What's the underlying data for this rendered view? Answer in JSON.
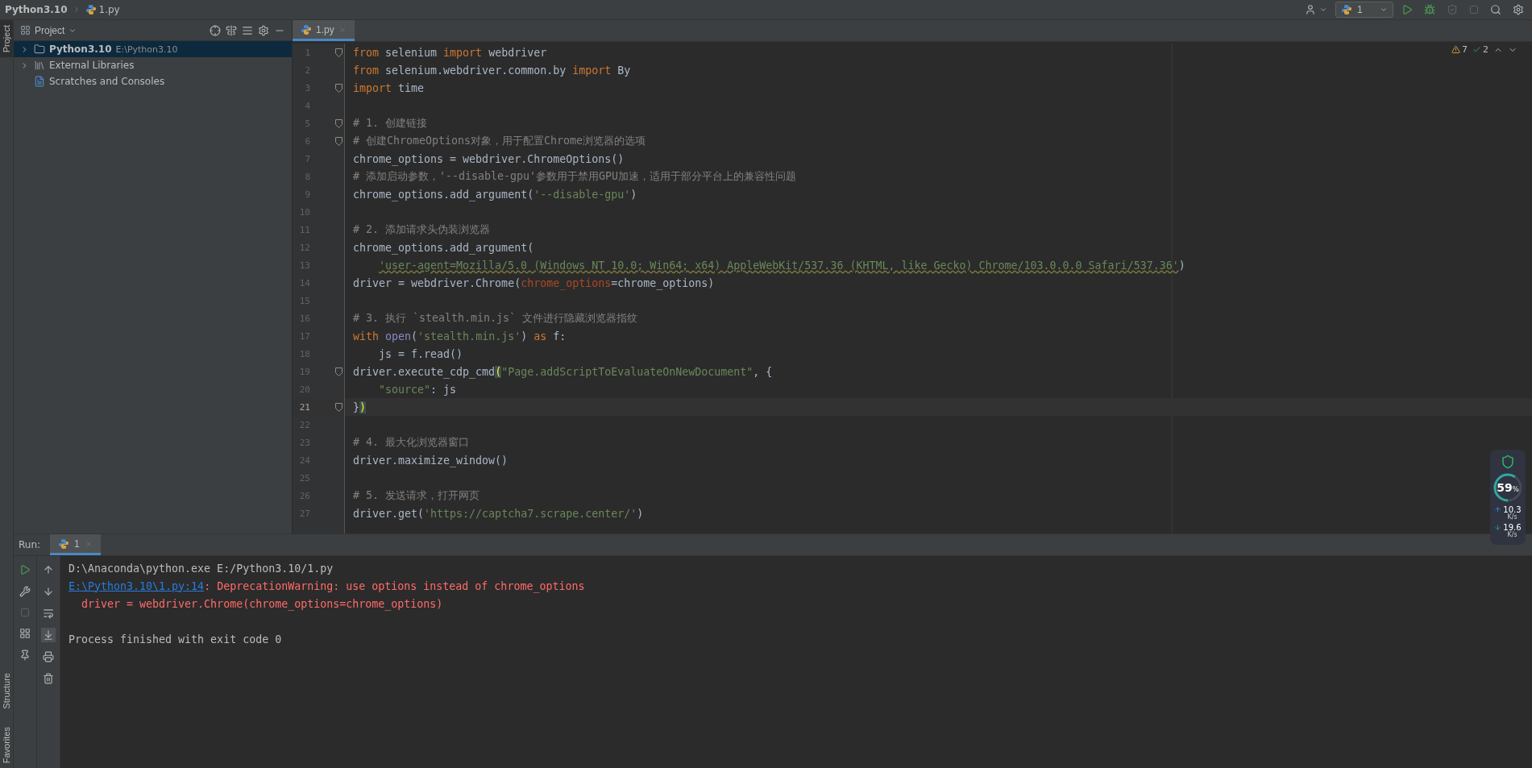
{
  "breadcrumbs": [
    {
      "label": "Python3.10",
      "kind": "folder"
    },
    {
      "label": "1.py",
      "kind": "file"
    }
  ],
  "toolbar": {
    "run_config": "1"
  },
  "side_tabs_top": [
    {
      "label": "Project",
      "selected": true
    }
  ],
  "side_tabs_bottom": [
    {
      "label": "Structure",
      "selected": false
    },
    {
      "label": "Favorites",
      "selected": false
    }
  ],
  "project": {
    "title": "Project",
    "tree": [
      {
        "label": "Python3.10",
        "path": "E:\\Python3.10",
        "kind": "folder",
        "selected": true,
        "expanded": false
      },
      {
        "label": "External Libraries",
        "kind": "library",
        "selected": false,
        "expanded": false
      },
      {
        "label": "Scratches and Consoles",
        "kind": "scratch",
        "selected": false
      }
    ]
  },
  "editor": {
    "tabs": [
      {
        "label": "1.py",
        "selected": true
      }
    ],
    "inspections": {
      "warnings": "7",
      "ok": "2"
    },
    "lines": [
      {
        "number": "1",
        "fold": true,
        "selected": false,
        "tokens": [
          {
            "kind": "kw",
            "text": "from"
          },
          {
            "kind": "plain",
            "text": " selenium "
          },
          {
            "kind": "kw",
            "text": "import"
          },
          {
            "kind": "plain",
            "text": " webdriver"
          }
        ]
      },
      {
        "number": "2",
        "fold": false,
        "selected": false,
        "tokens": [
          {
            "kind": "kw",
            "text": "from"
          },
          {
            "kind": "plain",
            "text": " selenium.webdriver.common.by "
          },
          {
            "kind": "kw",
            "text": "import"
          },
          {
            "kind": "plain",
            "text": " By"
          }
        ]
      },
      {
        "number": "3",
        "fold": true,
        "selected": false,
        "tokens": [
          {
            "kind": "kw",
            "text": "import"
          },
          {
            "kind": "plain",
            "text": " time"
          }
        ]
      },
      {
        "number": "4",
        "fold": false,
        "selected": false
      },
      {
        "number": "5",
        "fold": true,
        "selected": false,
        "tokens": [
          {
            "kind": "comment",
            "text": "# 1. 创建链接"
          }
        ]
      },
      {
        "number": "6",
        "fold": true,
        "selected": false,
        "tokens": [
          {
            "kind": "comment",
            "text": "# 创建ChromeOptions对象，用于配置Chrome浏览器的选项"
          }
        ]
      },
      {
        "number": "7",
        "fold": false,
        "selected": false,
        "tokens": [
          {
            "kind": "plain",
            "text": "chrome_options = webdriver.ChromeOptions()"
          }
        ]
      },
      {
        "number": "8",
        "fold": false,
        "selected": false,
        "tokens": [
          {
            "kind": "comment",
            "text": "# 添加启动参数，'--disable-gpu'参数用于禁用GPU加速，适用于部分平台上的兼容性问题"
          }
        ]
      },
      {
        "number": "9",
        "fold": false,
        "selected": false,
        "tokens": [
          {
            "kind": "plain",
            "text": "chrome_options.add_argument("
          },
          {
            "kind": "str",
            "text": "'--disable-gpu'"
          },
          {
            "kind": "plain",
            "text": ")"
          }
        ]
      },
      {
        "number": "10",
        "fold": false,
        "selected": false
      },
      {
        "number": "11",
        "fold": false,
        "selected": false,
        "tokens": [
          {
            "kind": "comment",
            "text": "# 2. 添加请求头伪装浏览器"
          }
        ]
      },
      {
        "number": "12",
        "fold": false,
        "selected": false,
        "tokens": [
          {
            "kind": "plain",
            "text": "chrome_options.add_argument("
          }
        ]
      },
      {
        "number": "13",
        "fold": false,
        "selected": false,
        "indented": true,
        "tokens": [
          {
            "kind": "str_warn",
            "text": "'user-agent=Mozilla/5.0 (Windows NT 10.0; Win64; x64) AppleWebKit/537.36 (KHTML, like Gecko) Chrome/103.0.0.0 Safari/537.36'"
          },
          {
            "kind": "plain",
            "text": ")"
          }
        ]
      },
      {
        "number": "14",
        "fold": false,
        "selected": false,
        "tokens": [
          {
            "kind": "plain",
            "text": "driver = webdriver.Chrome("
          },
          {
            "kind": "param",
            "text": "chrome_options"
          },
          {
            "kind": "plain",
            "text": "=chrome_options)"
          }
        ]
      },
      {
        "number": "15",
        "fold": false,
        "selected": false
      },
      {
        "number": "16",
        "fold": false,
        "selected": false,
        "tokens": [
          {
            "kind": "comment",
            "text": "# 3. 执行 `stealth.min.js` 文件进行隐藏浏览器指纹"
          }
        ]
      },
      {
        "number": "17",
        "fold": false,
        "selected": false,
        "tokens": [
          {
            "kind": "kw",
            "text": "with "
          },
          {
            "kind": "builtin",
            "text": "open"
          },
          {
            "kind": "plain",
            "text": "("
          },
          {
            "kind": "str",
            "text": "'stealth.min.js'"
          },
          {
            "kind": "plain",
            "text": ") "
          },
          {
            "kind": "kw",
            "text": "as"
          },
          {
            "kind": "plain",
            "text": " f:"
          }
        ]
      },
      {
        "number": "18",
        "fold": false,
        "selected": false,
        "tokens": [
          {
            "kind": "plain",
            "text": "    js = f.read()"
          }
        ]
      },
      {
        "number": "19",
        "fold": true,
        "selected": false,
        "tokens": [
          {
            "kind": "plain",
            "text": "driver.execute_cdp_cmd"
          },
          {
            "kind": "brace",
            "text": "("
          },
          {
            "kind": "str",
            "text": "\"Page.addScriptToEvaluateOnNewDocument\""
          },
          {
            "kind": "plain",
            "text": ", {"
          }
        ]
      },
      {
        "number": "20",
        "fold": false,
        "selected": false,
        "indented": true,
        "tokens": [
          {
            "kind": "str",
            "text": "\"source\""
          },
          {
            "kind": "plain",
            "text": ": js"
          }
        ]
      },
      {
        "number": "21",
        "fold": true,
        "selected": true,
        "tokens": [
          {
            "kind": "plain",
            "text": "}"
          },
          {
            "kind": "brace",
            "text": ")"
          }
        ]
      },
      {
        "number": "22",
        "fold": false,
        "selected": false
      },
      {
        "number": "23",
        "fold": false,
        "selected": false,
        "tokens": [
          {
            "kind": "comment",
            "text": "# 4. 最大化浏览器窗口"
          }
        ]
      },
      {
        "number": "24",
        "fold": false,
        "selected": false,
        "tokens": [
          {
            "kind": "plain",
            "text": "driver.maximize_window()"
          }
        ]
      },
      {
        "number": "25",
        "fold": false,
        "selected": false
      },
      {
        "number": "26",
        "fold": false,
        "selected": false,
        "tokens": [
          {
            "kind": "comment",
            "text": "# 5. 发送请求，打开网页"
          }
        ]
      },
      {
        "number": "27",
        "fold": false,
        "selected": false,
        "tokens": [
          {
            "kind": "plain",
            "text": "driver.get("
          },
          {
            "kind": "str",
            "text": "'https://captcha7.scrape.center/'"
          },
          {
            "kind": "plain",
            "text": ")"
          }
        ]
      }
    ]
  },
  "run": {
    "title": "Run:",
    "tabs": [
      {
        "label": "1",
        "selected": true
      }
    ],
    "console": [
      {
        "spaced": false,
        "tokens": [
          {
            "kind": "plain",
            "text": "D:\\Anaconda\\python.exe E:/Python3.10/1.py"
          }
        ]
      },
      {
        "spaced": false,
        "tokens": [
          {
            "kind": "link",
            "text": "E:\\Python3.10\\1.py:14"
          },
          {
            "kind": "error",
            "text": ": DeprecationWarning: use options instead of chrome_options"
          }
        ]
      },
      {
        "spaced": false,
        "tokens": [
          {
            "kind": "error",
            "text": "  driver = webdriver.Chrome(chrome_options=chrome_options)"
          }
        ]
      },
      {
        "spaced": true,
        "tokens": [
          {
            "kind": "plain",
            "text": "Process finished with exit code 0"
          }
        ]
      }
    ]
  },
  "monitor": {
    "level": 0.59,
    "value": "59",
    "unit": "%",
    "upload": "10.3",
    "upload_unit": "K/s",
    "download": "19.6",
    "download_unit": "K/s"
  }
}
